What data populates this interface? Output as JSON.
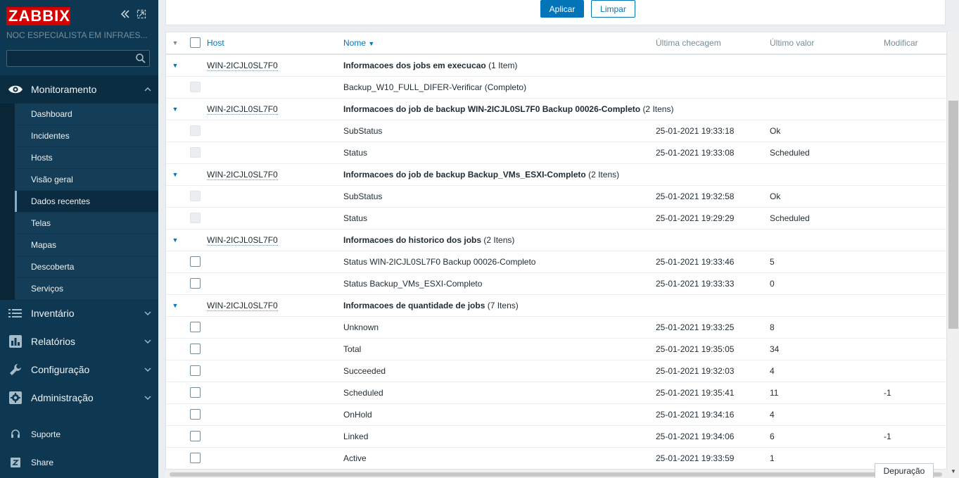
{
  "sidebar": {
    "logo": "ZABBIX",
    "server_name": "NOC ESPECIALISTA EM INFRAES...",
    "search_placeholder": "",
    "monitoring": {
      "label": "Monitoramento",
      "items": [
        {
          "label": "Dashboard"
        },
        {
          "label": "Incidentes"
        },
        {
          "label": "Hosts"
        },
        {
          "label": "Visão geral"
        },
        {
          "label": "Dados recentes",
          "active": true
        },
        {
          "label": "Telas"
        },
        {
          "label": "Mapas"
        },
        {
          "label": "Descoberta"
        },
        {
          "label": "Serviços"
        }
      ]
    },
    "sections": [
      {
        "label": "Inventário",
        "icon": "list-icon"
      },
      {
        "label": "Relatórios",
        "icon": "bar-chart-icon"
      },
      {
        "label": "Configuração",
        "icon": "wrench-icon"
      },
      {
        "label": "Administração",
        "icon": "gear-icon"
      }
    ],
    "bottom": [
      {
        "label": "Suporte",
        "icon": "headset-icon"
      },
      {
        "label": "Share",
        "icon": "zabbix-share-icon"
      }
    ]
  },
  "filter": {
    "apply_label": "Aplicar",
    "clear_label": "Limpar"
  },
  "table": {
    "headers": {
      "host": "Host",
      "name": "Nome",
      "last_check": "Última checagem",
      "last_value": "Último valor",
      "change": "Modificar"
    },
    "rows": [
      {
        "type": "app",
        "host": "WIN-2ICJL0SL7F0",
        "name": "Informacoes dos jobs em execucao",
        "count": "(1 Item)"
      },
      {
        "type": "item",
        "disabled": true,
        "name": "Backup_W10_FULL_DIFER-Verificar (Completo)",
        "last_check": "",
        "last_value": "",
        "change": ""
      },
      {
        "type": "app",
        "host": "WIN-2ICJL0SL7F0",
        "name": "Informacoes do job de backup WIN-2ICJL0SL7F0 Backup 00026-Completo",
        "count": "(2 Itens)"
      },
      {
        "type": "item",
        "disabled": true,
        "name": "SubStatus",
        "last_check": "25-01-2021 19:33:18",
        "last_value": "Ok",
        "change": ""
      },
      {
        "type": "item",
        "disabled": true,
        "name": "Status",
        "last_check": "25-01-2021 19:33:08",
        "last_value": "Scheduled",
        "change": ""
      },
      {
        "type": "app",
        "host": "WIN-2ICJL0SL7F0",
        "name": "Informacoes do job de backup Backup_VMs_ESXI-Completo",
        "count": "(2 Itens)"
      },
      {
        "type": "item",
        "disabled": true,
        "name": "SubStatus",
        "last_check": "25-01-2021 19:32:58",
        "last_value": "Ok",
        "change": ""
      },
      {
        "type": "item",
        "disabled": true,
        "name": "Status",
        "last_check": "25-01-2021 19:29:29",
        "last_value": "Scheduled",
        "change": ""
      },
      {
        "type": "app",
        "host": "WIN-2ICJL0SL7F0",
        "name": "Informacoes do historico dos jobs",
        "count": "(2 Itens)"
      },
      {
        "type": "item",
        "disabled": false,
        "name": "Status WIN-2ICJL0SL7F0 Backup 00026-Completo",
        "last_check": "25-01-2021 19:33:46",
        "last_value": "5",
        "change": ""
      },
      {
        "type": "item",
        "disabled": false,
        "name": "Status Backup_VMs_ESXI-Completo",
        "last_check": "25-01-2021 19:33:33",
        "last_value": "0",
        "change": ""
      },
      {
        "type": "app",
        "host": "WIN-2ICJL0SL7F0",
        "name": "Informacoes de quantidade de jobs",
        "count": "(7 Itens)"
      },
      {
        "type": "item",
        "disabled": false,
        "name": "Unknown",
        "last_check": "25-01-2021 19:33:25",
        "last_value": "8",
        "change": ""
      },
      {
        "type": "item",
        "disabled": false,
        "name": "Total",
        "last_check": "25-01-2021 19:35:05",
        "last_value": "34",
        "change": ""
      },
      {
        "type": "item",
        "disabled": false,
        "name": "Succeeded",
        "last_check": "25-01-2021 19:32:03",
        "last_value": "4",
        "change": ""
      },
      {
        "type": "item",
        "disabled": false,
        "name": "Scheduled",
        "last_check": "25-01-2021 19:35:41",
        "last_value": "11",
        "change": "-1"
      },
      {
        "type": "item",
        "disabled": false,
        "name": "OnHold",
        "last_check": "25-01-2021 19:34:16",
        "last_value": "4",
        "change": ""
      },
      {
        "type": "item",
        "disabled": false,
        "name": "Linked",
        "last_check": "25-01-2021 19:34:06",
        "last_value": "6",
        "change": "-1"
      },
      {
        "type": "item",
        "disabled": false,
        "name": "Active",
        "last_check": "25-01-2021 19:33:59",
        "last_value": "1",
        "change": ""
      }
    ]
  },
  "debug_label": "Depuração",
  "colors": {
    "sidebar_bg": "#0e3852",
    "logo_red": "#d40000",
    "accent_blue": "#0275b8"
  }
}
